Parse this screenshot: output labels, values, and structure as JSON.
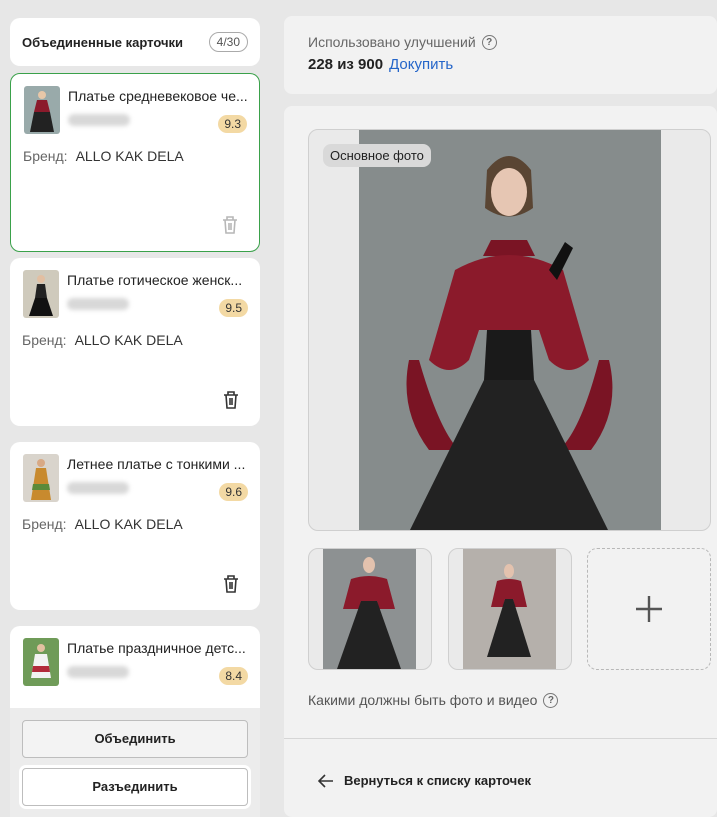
{
  "sidebar": {
    "title": "Объединенные карточки",
    "counter": "4/30",
    "brand_label": "Бренд:",
    "cards": [
      {
        "title": "Платье средневековое че...",
        "rating": "9.3",
        "brand": "ALLO KAK DELA",
        "selected": true
      },
      {
        "title": "Платье готическое женск...",
        "rating": "9.5",
        "brand": "ALLO KAK DELA",
        "selected": false
      },
      {
        "title": "Летнее платье с тонкими ...",
        "rating": "9.6",
        "brand": "ALLO KAK DELA",
        "selected": false
      },
      {
        "title": "Платье праздничное детс...",
        "rating": "8.4",
        "brand": "",
        "selected": false
      }
    ],
    "merge_button": "Объединить",
    "unmerge_button": "Разъединить"
  },
  "usage": {
    "label": "Использовано улучшений",
    "value": "228 из 900",
    "buy_link": "Докупить"
  },
  "photos": {
    "main_label": "Основное фото",
    "hint": "Какими должны быть фото и видео"
  },
  "footer": {
    "back_label": "Вернуться к списку карточек"
  },
  "colors": {
    "accent_link": "#2465c9",
    "selected_border": "#3aa14a",
    "rating_badge": "#f3d9a4"
  }
}
